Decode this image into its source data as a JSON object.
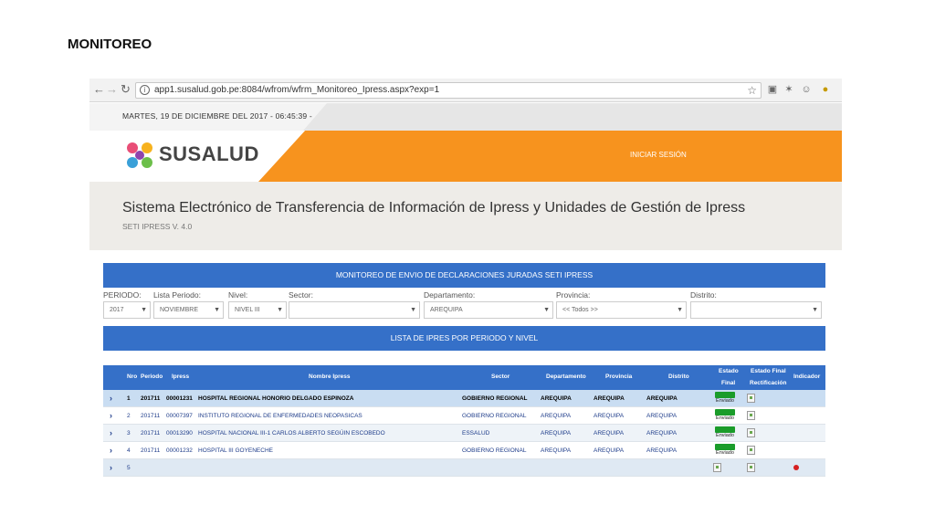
{
  "slide": {
    "title": "MONITOREO"
  },
  "browser": {
    "url": "app1.susalud.gob.pe:8084/wfrom/wfrm_Monitoreo_Ipress.aspx?exp=1",
    "icons": [
      "back-icon",
      "forward-icon",
      "reload-icon",
      "info-icon",
      "star-icon"
    ]
  },
  "site": {
    "date": "MARTES, 19 DE DICIEMBRE DEL 2017 - 06:45:39 -",
    "logo": "SUSALUD",
    "login": "INICIAR SESIÓN",
    "system_title": "Sistema Electrónico de Transferencia de Información de Ipress y Unidades de Gestión de Ipress",
    "system_version": "SETI IPRESS V. 4.0"
  },
  "monitor": {
    "title": "MONITOREO DE ENVIO DE DECLARACIONES JURADAS SETI IPRESS",
    "list_title": "LISTA DE IPRES POR PERIODO Y NIVEL"
  },
  "filters": {
    "periodo": {
      "label": "PERIODO:",
      "value": "2017"
    },
    "lista_periodo": {
      "label": "Lista Periodo:",
      "value": "NOVIEMBRE"
    },
    "nivel": {
      "label": "Nivel:",
      "value": "NIVEL III"
    },
    "sector": {
      "label": "Sector:",
      "value": ""
    },
    "departamento": {
      "label": "Departamento:",
      "value": "AREQUIPA"
    },
    "provincia": {
      "label": "Provincia:",
      "value": "<< Todos >>"
    },
    "distrito": {
      "label": "Distrito:",
      "value": ""
    }
  },
  "table": {
    "headers": {
      "nro": "Nro",
      "periodo": "Periodo",
      "ipress": "Ipress",
      "nombre": "Nombre Ipress",
      "sector": "Sector",
      "departamento": "Departamento",
      "provincia": "Provincia",
      "distrito": "Distrito",
      "estado_final_1": "Estado",
      "estado_final_2": "Final",
      "estado_rect_1": "Estado Final",
      "estado_rect_2": "Rectificación",
      "indicador": "Indicador"
    },
    "rows": [
      {
        "nro": "1",
        "periodo": "201711",
        "ipress": "00001231",
        "nombre": "HOSPITAL REGIONAL HONORIO DELGADO ESPINOZA",
        "sector": "GOBIERNO REGIONAL",
        "departamento": "AREQUIPA",
        "provincia": "AREQUIPA",
        "distrito": "AREQUIPA",
        "estado": "Enviado"
      },
      {
        "nro": "2",
        "periodo": "201711",
        "ipress": "00007397",
        "nombre": "INSTITUTO REGIONAL DE ENFERMEDADES NEOPASICAS",
        "sector": "GOBIERNO REGIONAL",
        "departamento": "AREQUIPA",
        "provincia": "AREQUIPA",
        "distrito": "AREQUIPA",
        "estado": "Enviado"
      },
      {
        "nro": "3",
        "periodo": "201711",
        "ipress": "00013290",
        "nombre": "HOSPITAL NACIONAL III-1 CARLOS ALBERTO SEGÚIN ESCOBEDO",
        "sector": "ESSALUD",
        "departamento": "AREQUIPA",
        "provincia": "AREQUIPA",
        "distrito": "AREQUIPA",
        "estado": "Enviado"
      },
      {
        "nro": "4",
        "periodo": "201711",
        "ipress": "00001232",
        "nombre": "HOSPITAL III GOYENECHE",
        "sector": "GOBIERNO REGIONAL",
        "departamento": "AREQUIPA",
        "provincia": "AREQUIPA",
        "distrito": "AREQUIPA",
        "estado": "Enviado"
      },
      {
        "nro": "5"
      }
    ]
  },
  "colors": {
    "orange": "#f7931e",
    "blue": "#3570c8",
    "green": "#1a9c2a",
    "red": "#d62020"
  }
}
